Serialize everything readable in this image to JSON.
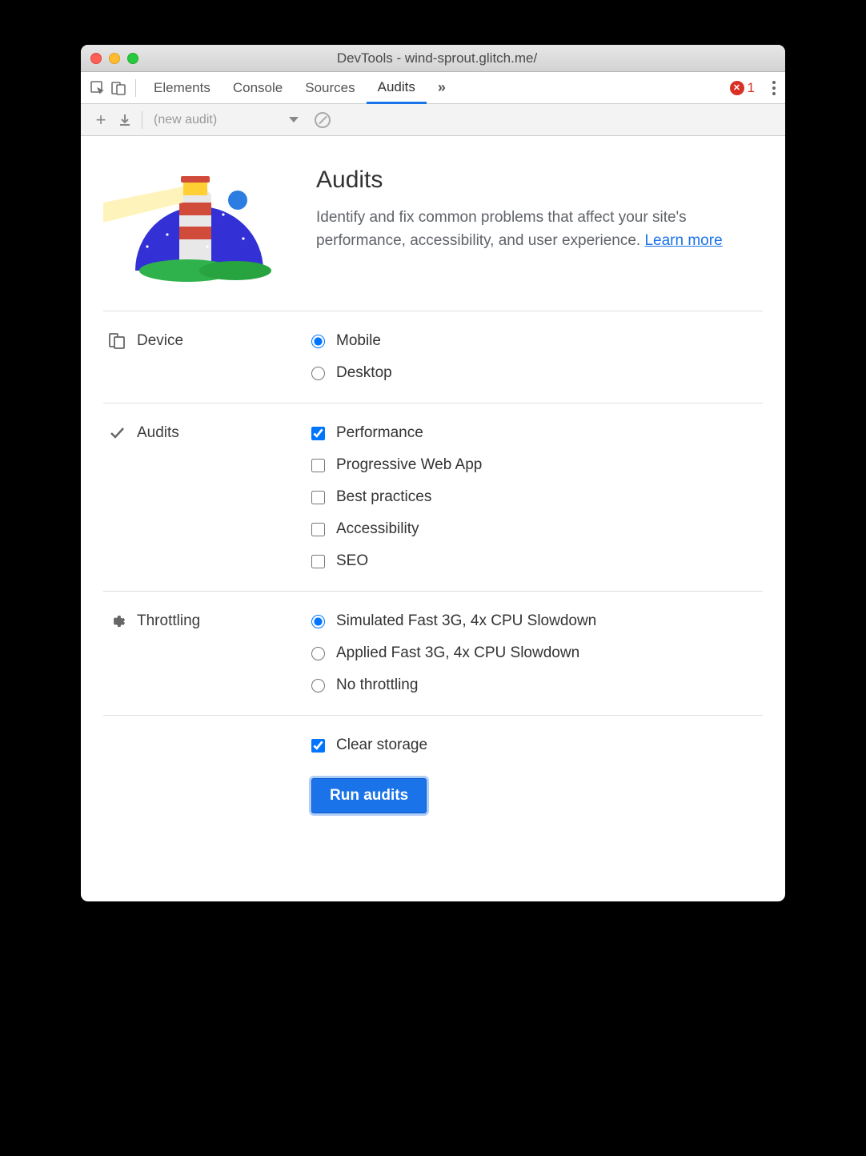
{
  "window": {
    "title": "DevTools - wind-sprout.glitch.me/"
  },
  "tabs": {
    "elements": "Elements",
    "console": "Console",
    "sources": "Sources",
    "audits": "Audits",
    "more": "»",
    "error_count": "1"
  },
  "subbar": {
    "selector": "(new audit)"
  },
  "hero": {
    "title": "Audits",
    "desc_before": "Identify and fix common problems that affect your site's performance, accessibility, and user experience. ",
    "learn_more": "Learn more"
  },
  "sections": {
    "device": {
      "label": "Device",
      "options": {
        "mobile": "Mobile",
        "desktop": "Desktop"
      },
      "selected": "mobile"
    },
    "audits": {
      "label": "Audits",
      "options": {
        "performance": "Performance",
        "pwa": "Progressive Web App",
        "best_practices": "Best practices",
        "accessibility": "Accessibility",
        "seo": "SEO"
      },
      "checked": [
        "performance"
      ]
    },
    "throttling": {
      "label": "Throttling",
      "options": {
        "sim": "Simulated Fast 3G, 4x CPU Slowdown",
        "applied": "Applied Fast 3G, 4x CPU Slowdown",
        "none": "No throttling"
      },
      "selected": "sim"
    },
    "clear_storage": {
      "label": "Clear storage",
      "checked": true
    }
  },
  "run_button": "Run audits"
}
